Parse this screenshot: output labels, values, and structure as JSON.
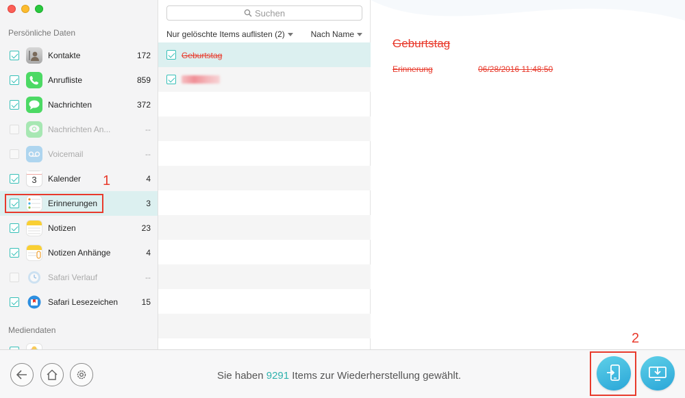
{
  "sidebar": {
    "section_personal": "Persönliche Daten",
    "section_media": "Mediendaten",
    "items": [
      {
        "label": "Kontakte",
        "count": "172",
        "icon": "contacts-icon",
        "state": "on"
      },
      {
        "label": "Anrufliste",
        "count": "859",
        "icon": "phone-icon",
        "state": "on"
      },
      {
        "label": "Nachrichten",
        "count": "372",
        "icon": "messages-icon",
        "state": "on"
      },
      {
        "label": "Nachrichten An...",
        "count": "--",
        "icon": "message-attachments-icon",
        "state": "off"
      },
      {
        "label": "Voicemail",
        "count": "--",
        "icon": "voicemail-icon",
        "state": "off"
      },
      {
        "label": "Kalender",
        "count": "4",
        "icon": "calendar-icon",
        "state": "on",
        "calendar_day": "3"
      },
      {
        "label": "Erinnerungen",
        "count": "3",
        "icon": "reminders-icon",
        "state": "on",
        "selected": true
      },
      {
        "label": "Notizen",
        "count": "23",
        "icon": "notes-icon",
        "state": "on"
      },
      {
        "label": "Notizen Anhänge",
        "count": "4",
        "icon": "notes-attachments-icon",
        "state": "on"
      },
      {
        "label": "Safari Verlauf",
        "count": "--",
        "icon": "safari-history-icon",
        "state": "off"
      },
      {
        "label": "Safari Lesezeichen",
        "count": "15",
        "icon": "safari-bookmarks-icon",
        "state": "on"
      }
    ]
  },
  "annotations": {
    "step1": "1",
    "step2": "2"
  },
  "list": {
    "search_placeholder": "Suchen",
    "filter_label": "Nur gelöschte Items auflisten (2)",
    "sort_label": "Nach Name",
    "rows": [
      {
        "title": "Geburtstag",
        "checked": true,
        "selected": true
      },
      {
        "title": "",
        "checked": true,
        "blurred": true
      }
    ]
  },
  "detail": {
    "title": "Geburtstag",
    "field_label": "Erinnerung",
    "field_value": "06/28/2016 11:48:50"
  },
  "bottom": {
    "status_prefix": "Sie haben",
    "status_count": "9291",
    "status_suffix": "Items zur Wiederherstellung gewählt."
  },
  "colors": {
    "accent": "#35bfb7",
    "deleted_red": "#e8392b",
    "selected_bg": "#dcf0f0",
    "button_blue": "#2aa6d8"
  }
}
